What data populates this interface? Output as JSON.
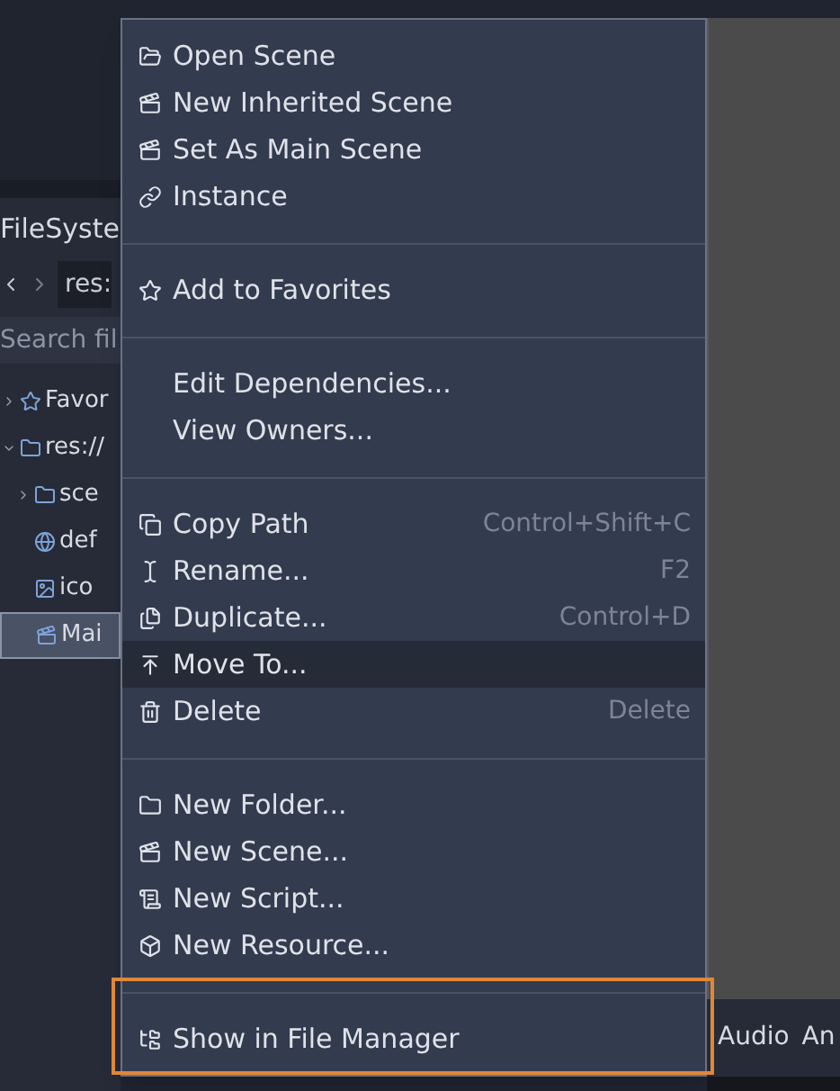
{
  "filesystem": {
    "title": "FileSyste",
    "path": "res:",
    "search": {
      "placeholder": "Search fil"
    },
    "tree": [
      {
        "label": "Favor",
        "expanded": false,
        "selected": false
      },
      {
        "label": "res://",
        "expanded": true,
        "selected": false,
        "children": [
          {
            "label": "sce",
            "expanded": false,
            "selected": false
          },
          {
            "label": "def",
            "selected": false
          },
          {
            "label": "ico",
            "selected": false
          },
          {
            "label": "Mai",
            "selected": true
          }
        ]
      }
    ]
  },
  "bottom_tabs": [
    "Audio",
    "An"
  ],
  "context_menu": {
    "items": [
      {
        "kind": "item",
        "label": "Open Scene",
        "hovered": false
      },
      {
        "kind": "item",
        "label": "New Inherited Scene",
        "hovered": false
      },
      {
        "kind": "item",
        "label": "Set As Main Scene",
        "hovered": false
      },
      {
        "kind": "item",
        "label": "Instance",
        "hovered": false
      },
      {
        "kind": "separator"
      },
      {
        "kind": "item",
        "label": "Add to Favorites",
        "hovered": false
      },
      {
        "kind": "separator"
      },
      {
        "kind": "item",
        "label": "Edit Dependencies...",
        "hovered": false
      },
      {
        "kind": "item",
        "label": "View Owners...",
        "hovered": false
      },
      {
        "kind": "separator"
      },
      {
        "kind": "item",
        "label": "Copy Path",
        "shortcut": "Control+Shift+C",
        "hovered": false
      },
      {
        "kind": "item",
        "label": "Rename...",
        "shortcut": "F2",
        "hovered": false
      },
      {
        "kind": "item",
        "label": "Duplicate...",
        "shortcut": "Control+D",
        "hovered": false
      },
      {
        "kind": "item",
        "label": "Move To...",
        "hovered": true
      },
      {
        "kind": "item",
        "label": "Delete",
        "shortcut": "Delete",
        "hovered": false
      },
      {
        "kind": "separator"
      },
      {
        "kind": "item",
        "label": "New Folder...",
        "hovered": false
      },
      {
        "kind": "item",
        "label": "New Scene...",
        "hovered": false
      },
      {
        "kind": "item",
        "label": "New Script...",
        "hovered": false
      },
      {
        "kind": "item",
        "label": "New Resource...",
        "hovered": false
      },
      {
        "kind": "separator",
        "highlighted": true
      },
      {
        "kind": "item",
        "label": "Show in File Manager",
        "hovered": false,
        "highlighted": true
      }
    ]
  }
}
